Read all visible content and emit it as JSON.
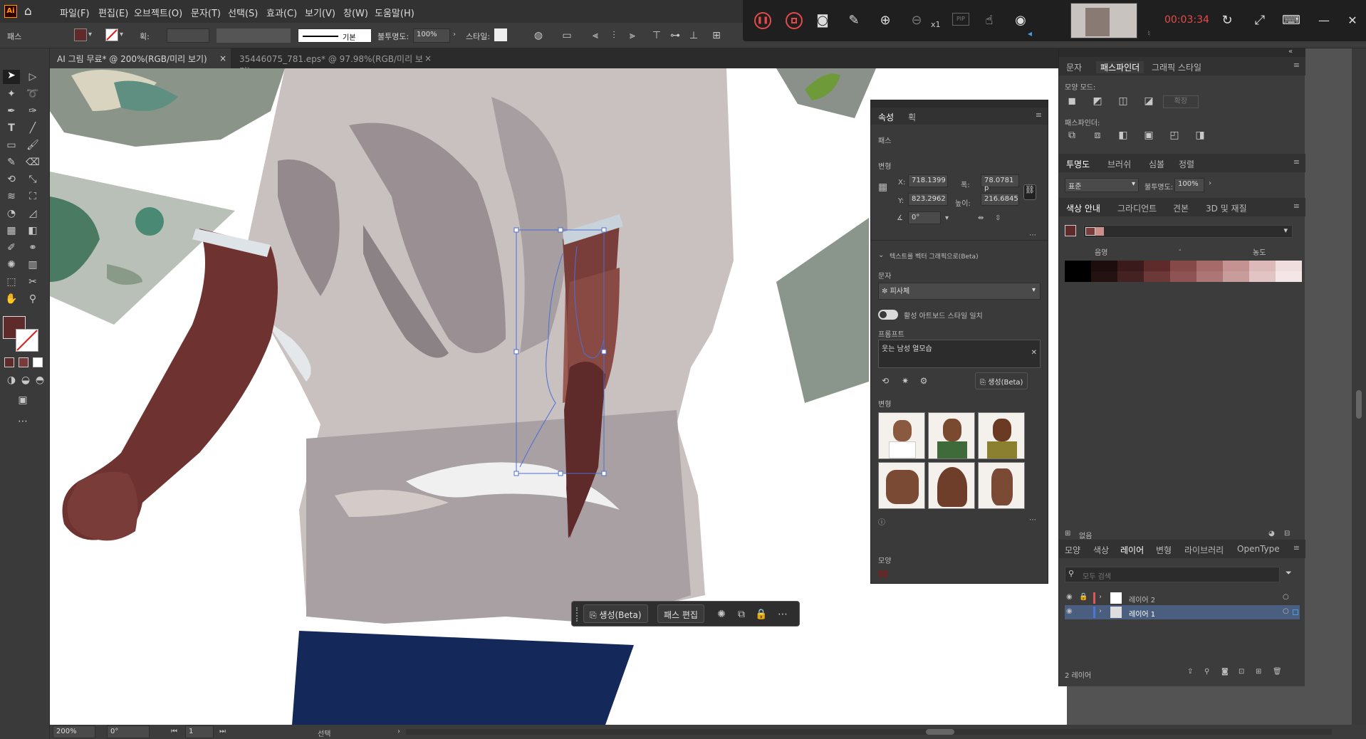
{
  "app": {
    "logo": "Ai"
  },
  "menu": [
    "파일(F)",
    "편집(E)",
    "오브젝트(O)",
    "문자(T)",
    "선택(S)",
    "효과(C)",
    "보기(V)",
    "창(W)",
    "도움말(H)"
  ],
  "control": {
    "object_type": "패스",
    "stroke_label": "획:",
    "stroke_style": "기본",
    "opacity_label": "불투명도:",
    "opacity": "100%",
    "style_label": "스타일:"
  },
  "recorder": {
    "zoom": "x1",
    "pip": "PIP",
    "time": "00:03:34"
  },
  "tabs": [
    {
      "label": "AI 그림 무료* @ 200%(RGB/미리 보기)",
      "active": true
    },
    {
      "label": "35446075_781.eps* @ 97.98%(RGB/미리 보기)",
      "active": false
    }
  ],
  "properties": {
    "tabs": [
      "속성",
      "획"
    ],
    "type": "패스",
    "transform_title": "변형",
    "x_label": "X:",
    "x": "718.1399",
    "w_label": "폭:",
    "w": "78.0781 p",
    "y_label": "Y:",
    "y": "823.2962",
    "h_label": "높이:",
    "h": "216.6845",
    "angle": "0°",
    "text_to_vector": "텍스트를 벡터 그래픽으로(Beta)",
    "char_label": "문자",
    "subject": "피사체",
    "match_style": "활성 아트보드 스타일 일치",
    "prompt_label": "프롬프트",
    "prompt": "웃는 남성 얼모습",
    "generate": "생성(Beta)",
    "variations_label": "변형",
    "appearance_label": "모양"
  },
  "right": {
    "top_tabs": [
      "문자",
      "패스파인더",
      "그래픽 스타일"
    ],
    "shape_modes": "모양 모드:",
    "expand": "확장",
    "pathfinders": "패스파인더:",
    "mid_tabs": [
      "투명도",
      "브러쉬",
      "심볼",
      "정렬"
    ],
    "blend_mode": "표준",
    "opacity_label": "불투명도:",
    "opacity": "100%",
    "guide_tabs": [
      "색상 안내",
      "그라디언트",
      "견본",
      "3D 및 재질"
    ],
    "shade_label": "음영",
    "tint_label": "농도",
    "none_label": "없음",
    "layer_tabs": [
      "모양",
      "색상",
      "레이어",
      "변형",
      "라이브러리",
      "OpenType"
    ],
    "search_placeholder": "모두 검색",
    "layers": [
      "레이어 2",
      "레이어 1"
    ],
    "layer_count": "2 레이어",
    "colors": {
      "layer2": "#e05656",
      "layer1": "#4b78d6",
      "accent": "#5e2a2a"
    }
  },
  "context": {
    "generate": "생성(Beta)",
    "edit_path": "패스 편집"
  },
  "status": {
    "zoom": "200%",
    "angle": "0°",
    "artboard": "1",
    "tool": "선택"
  }
}
